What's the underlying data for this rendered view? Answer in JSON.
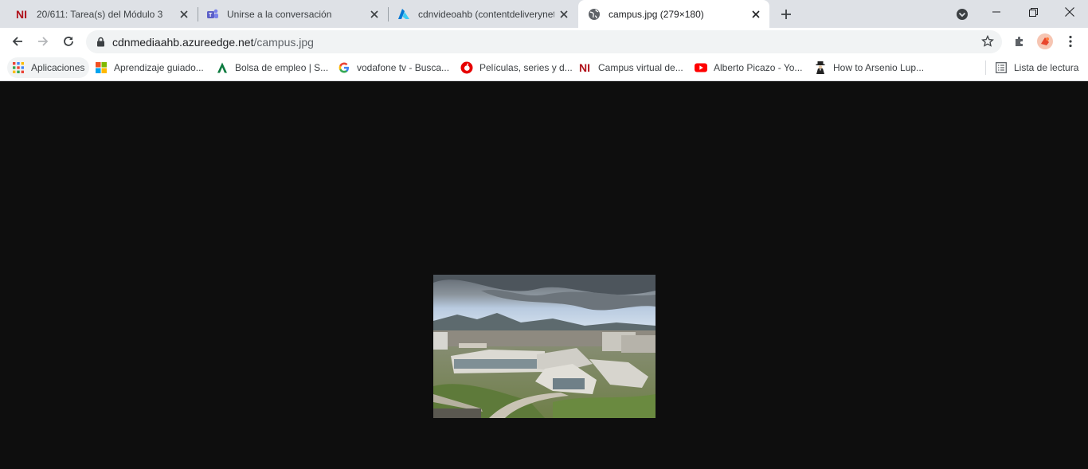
{
  "tabs": [
    {
      "title": "20/611: Tarea(s) del Módulo 3",
      "icon": "n-campus-icon",
      "active": false
    },
    {
      "title": "Unirse a la conversación",
      "icon": "teams-icon",
      "active": false
    },
    {
      "title": "cdnvideoahb (contentdeliverynet",
      "icon": "azure-icon",
      "active": false
    },
    {
      "title": "campus.jpg (279×180)",
      "icon": "globe-icon",
      "active": true
    }
  ],
  "toolbar": {
    "url_host": "cdnmediaahb.azureedge.net",
    "url_path": "/campus.jpg"
  },
  "bookmarks": [
    {
      "label": "Aplicaciones",
      "icon": "apps-grid-icon"
    },
    {
      "label": "Aprendizaje guiado...",
      "icon": "microsoft-icon"
    },
    {
      "label": "Bolsa de empleo | S...",
      "icon": "andalucia-icon"
    },
    {
      "label": "vodafone tv - Busca...",
      "icon": "google-icon"
    },
    {
      "label": "Películas, series y d...",
      "icon": "vodafone-icon"
    },
    {
      "label": "Campus virtual de...",
      "icon": "n-campus-icon"
    },
    {
      "label": "Alberto Picazo - Yo...",
      "icon": "youtube-icon"
    },
    {
      "label": "How to Arsenio Lup...",
      "icon": "arsenio-icon"
    }
  ],
  "reading_list": {
    "label": "Lista de lectura",
    "icon": "reading-list-icon"
  },
  "image": {
    "alt": "campus.jpg",
    "width": 279,
    "height": 180
  },
  "colors": {
    "tab_strip": "#dee1e6",
    "viewer_background": "#0e0e0e",
    "n_brand": "#b0121b",
    "teams": "#5b5fc7",
    "azure": "#0078d4"
  }
}
